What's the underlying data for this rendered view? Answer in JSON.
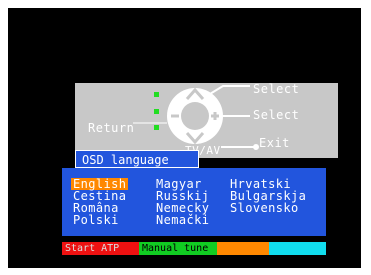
{
  "remote": {
    "select_top": "Select",
    "select_right": "Select",
    "exit": "Exit",
    "return": "Return",
    "tvav": "TV/AV"
  },
  "osd": {
    "title": "OSD language"
  },
  "languages": {
    "column1": [
      "English",
      "Cestina",
      "Româna",
      "Polski"
    ],
    "column2": [
      "Magyar",
      "Russkij",
      "Nemecky",
      "Nemački"
    ],
    "column3": [
      "Hrvatski",
      "Bulgarskja",
      "Slovensko"
    ],
    "selected": "English"
  },
  "color_keys": {
    "red_label": "Start ATP",
    "green_label": "Manual tune",
    "orange_label": "",
    "cyan_label": ""
  },
  "colors": {
    "screen_background": "#000000",
    "panel_gray": "#c8c8c8",
    "menu_blue": "#2255dd",
    "highlight_orange": "#ff8800",
    "key_red": "#ee1111",
    "key_green": "#11cc22",
    "key_orange": "#ff8800",
    "key_cyan": "#11ddee"
  }
}
